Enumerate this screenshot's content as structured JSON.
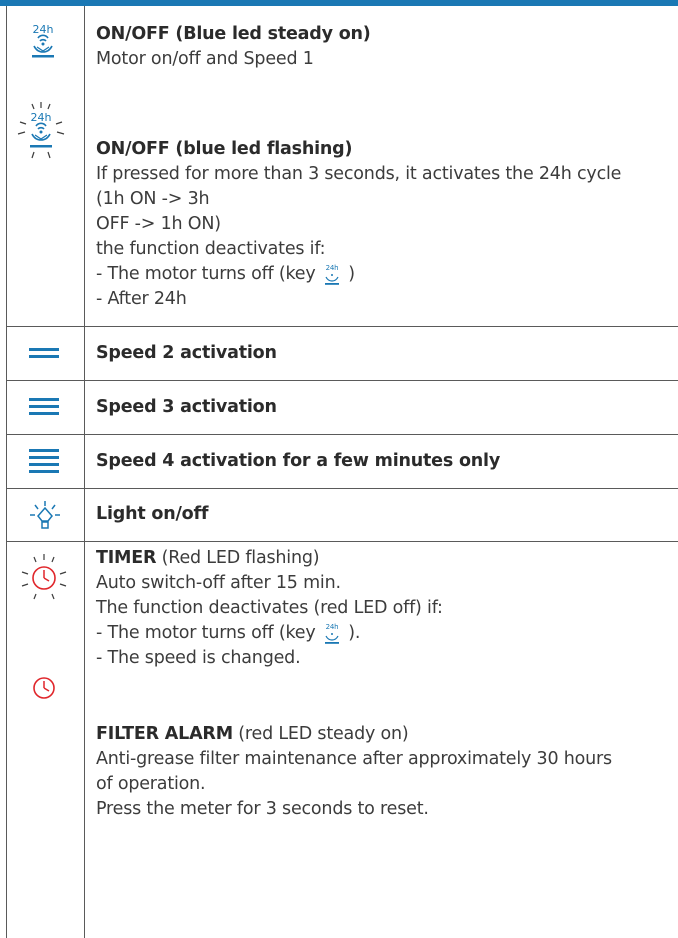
{
  "rows": [
    {
      "icon": "fan-24h-icon",
      "title": "ON/OFF (Blue led steady on)",
      "lines": [
        "Motor on/off and Speed 1"
      ]
    },
    {
      "icon": "fan-24h-flashing-icon",
      "title": "ON/OFF (blue led flashing)",
      "lines": [
        "If pressed for more than 3 seconds, it activates the 24h cycle",
        "(1h ON -> 3h",
        "OFF -> 1h ON)",
        "the function deactivates if:",
        "- The motor turns off (key",
        ")",
        "- After 24h"
      ]
    },
    {
      "icon": "speed-2-icon",
      "title": "Speed 2 activation"
    },
    {
      "icon": "speed-3-icon",
      "title": "Speed 3 activation"
    },
    {
      "icon": "speed-4-icon",
      "title": "Speed 4 activation for a few minutes only"
    },
    {
      "icon": "light-bulb-icon",
      "title": "Light on/off"
    },
    {
      "icon": "timer-icon",
      "timer": {
        "title": "TIMER",
        "subtitle": " (Red LED flashing)",
        "lines": [
          "Auto switch-off after 15 min.",
          "The function deactivates (red LED off) if:",
          "- The motor turns off (key",
          ").",
          "- The speed is changed."
        ]
      },
      "filter": {
        "title": "FILTER ALARM",
        "subtitle": " (red LED steady on)",
        "lines": [
          "Anti-grease filter maintenance after approximately 30 hours",
          "of operation.",
          "Press the meter for 3 seconds to reset."
        ]
      }
    }
  ],
  "colors": {
    "accent": "#1a78b4",
    "red": "#e0262b",
    "text": "#3c3c3c"
  }
}
